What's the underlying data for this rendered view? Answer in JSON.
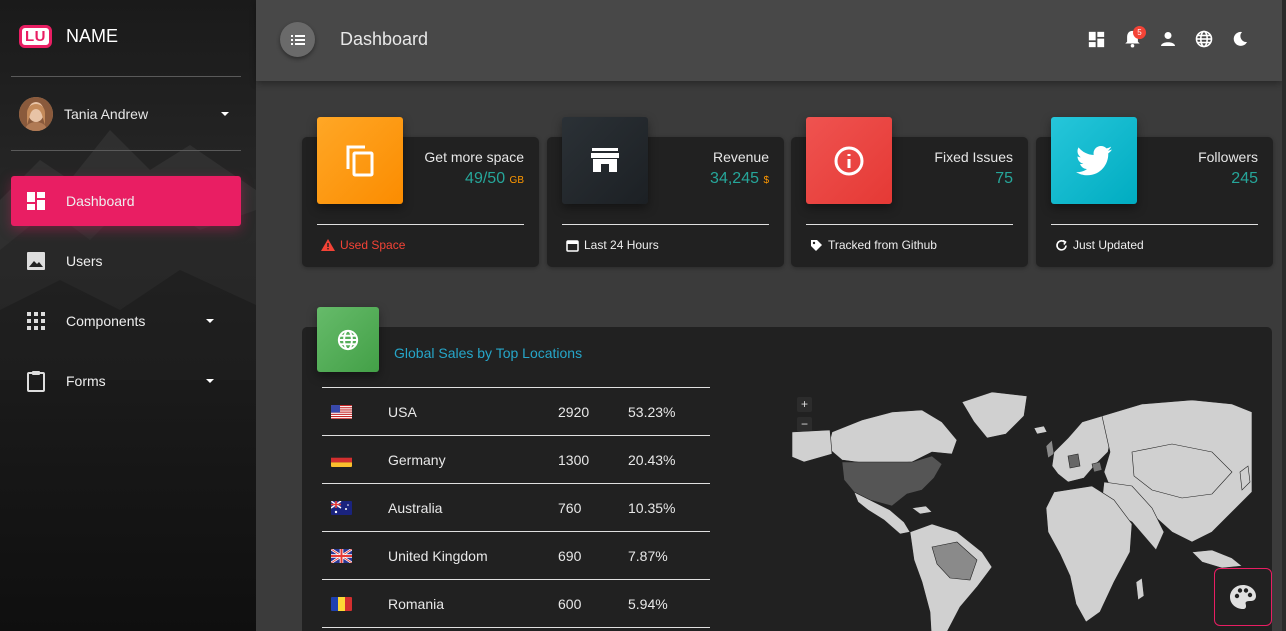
{
  "brand": {
    "logo_text": "LU",
    "name": "NAME",
    "accent": "#e91e63"
  },
  "user": {
    "name": "Tania Andrew"
  },
  "nav": [
    {
      "label": "Dashboard",
      "icon": "dashboard-icon",
      "active": true
    },
    {
      "label": "Users",
      "icon": "image-icon"
    },
    {
      "label": "Components",
      "icon": "apps-grid-icon",
      "has_submenu": true
    },
    {
      "label": "Forms",
      "icon": "clipboard-icon",
      "has_submenu": true
    }
  ],
  "topbar": {
    "title": "Dashboard",
    "notification_count": "5"
  },
  "stats": [
    {
      "title": "Get more space",
      "value": "49/50",
      "unit": "GB",
      "unit_color": "#ff9800",
      "footer": "Used Space",
      "footer_color": "#f44336",
      "icon": "copy-icon",
      "color": "#fb8c00"
    },
    {
      "title": "Revenue",
      "value": "34,245",
      "unit": "$",
      "unit_color": "#ff9800",
      "footer": "Last 24 Hours",
      "icon": "store-icon",
      "color": "#262626"
    },
    {
      "title": "Fixed Issues",
      "value": "75",
      "unit": "",
      "footer": "Tracked from Github",
      "icon": "info-icon",
      "color": "#e53935"
    },
    {
      "title": "Followers",
      "value": "245",
      "unit": "",
      "footer": "Just Updated",
      "icon": "twitter-icon",
      "color": "#00acc1"
    }
  ],
  "sales": {
    "title": "Global Sales by Top Locations",
    "rows": [
      {
        "country": "USA",
        "count": "2920",
        "percent": "53.23%"
      },
      {
        "country": "Germany",
        "count": "1300",
        "percent": "20.43%"
      },
      {
        "country": "Australia",
        "count": "760",
        "percent": "10.35%"
      },
      {
        "country": "United Kingdom",
        "count": "690",
        "percent": "7.87%"
      },
      {
        "country": "Romania",
        "count": "600",
        "percent": "5.94%"
      }
    ],
    "zoom_in": "+",
    "zoom_out": "−"
  }
}
